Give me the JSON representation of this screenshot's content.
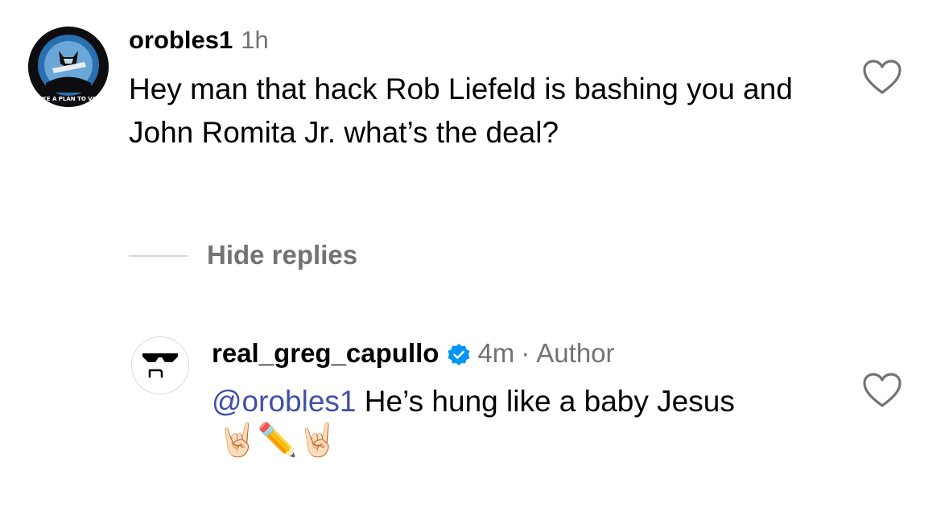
{
  "comment": {
    "username": "orobles1",
    "time": "1h",
    "text": "Hey man that hack Rob Liefeld is bashing you and John Romita Jr.  what’s the deal?",
    "avatar_text": "MAKE A PLAN TO VOTE",
    "like_icon": "heart-outline-icon"
  },
  "hide_replies_label": "Hide replies",
  "reply": {
    "username": "real_greg_capullo",
    "verified_icon": "verified-badge-icon",
    "time": "4m",
    "separator": "·",
    "author_label": "Author",
    "mention": "@orobles1",
    "text": "He’s hung like a baby Jesus",
    "emojis": "🤘🏻✏️🤘🏻",
    "like_icon": "heart-outline-icon"
  },
  "colors": {
    "text": "#000000",
    "secondary": "#737373",
    "mention": "#4150a6",
    "verified": "#0095f6",
    "divider": "#d8d8d8"
  }
}
